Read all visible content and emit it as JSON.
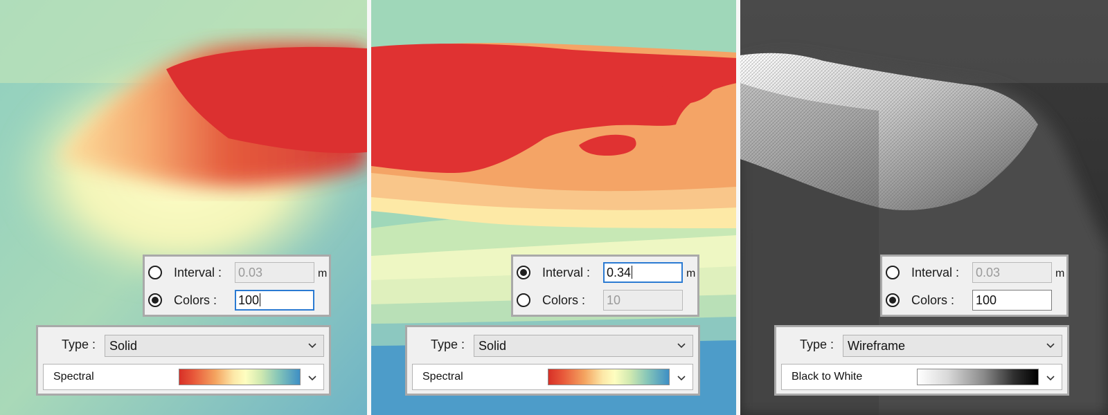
{
  "panels": [
    {
      "interval": {
        "label": "Interval :",
        "value": "0.03",
        "unit": "m",
        "selected": false,
        "active": false
      },
      "colors": {
        "label": "Colors :",
        "value": "100",
        "selected": true,
        "active": true
      },
      "type": {
        "label": "Type :",
        "value": "Solid"
      },
      "palette": {
        "name": "Spectral",
        "gradient": "spectral"
      }
    },
    {
      "interval": {
        "label": "Interval :",
        "value": "0.34",
        "unit": "m",
        "selected": true,
        "active": true
      },
      "colors": {
        "label": "Colors :",
        "value": "10",
        "selected": false,
        "active": false
      },
      "type": {
        "label": "Type :",
        "value": "Solid"
      },
      "palette": {
        "name": "Spectral",
        "gradient": "spectral"
      }
    },
    {
      "interval": {
        "label": "Interval :",
        "value": "0.03",
        "unit": "m",
        "selected": false,
        "active": false
      },
      "colors": {
        "label": "Colors :",
        "value": "100",
        "selected": true,
        "active": false
      },
      "type": {
        "label": "Type :",
        "value": "Wireframe"
      },
      "palette": {
        "name": "Black to White",
        "gradient": "bw"
      }
    }
  ],
  "colors": {
    "spectral_red": "#e03232",
    "spectral_orange": "#f4a460",
    "spectral_yellow": "#fdf0b5",
    "spectral_green": "#a0d6b4",
    "spectral_blue": "#3d8fc8",
    "focus_blue": "#2a7ad2"
  }
}
